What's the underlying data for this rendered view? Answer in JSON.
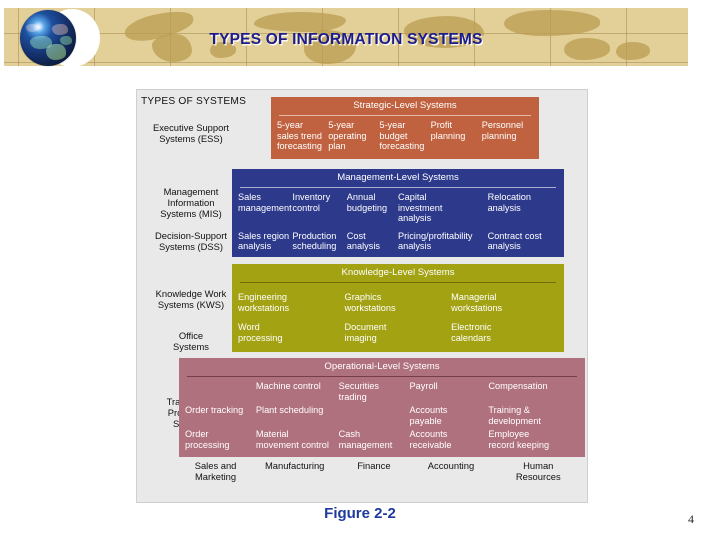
{
  "slide": {
    "banner_title": "TYPES OF INFORMATION SYSTEMS",
    "figure_caption": "Figure 2-2",
    "slide_number": "4"
  },
  "diagram": {
    "corner_label": "TYPES OF SYSTEMS",
    "system_types": [
      {
        "id": "ess",
        "label": "Executive Support\nSystems (ESS)"
      },
      {
        "id": "mis",
        "label": "Management\nInformation\nSystems (MIS)"
      },
      {
        "id": "dss",
        "label": "Decision-Support\nSystems (DSS)"
      },
      {
        "id": "kws",
        "label": "Knowledge Work\nSystems (KWS)"
      },
      {
        "id": "office",
        "label": "Office\nSystems"
      },
      {
        "id": "tps",
        "label": "Transaction\nProcessing\nSystems\n(TPS)"
      }
    ],
    "bands": [
      {
        "id": "strategic",
        "title": "Strategic-Level Systems",
        "color": "#C0623F",
        "rows": [
          [
            "5-year\nsales trend\nforecasting",
            "5-year\noperating\nplan",
            "5-year\nbudget\nforecasting",
            "Profit\nplanning",
            "Personnel\nplanning"
          ]
        ]
      },
      {
        "id": "management",
        "title": "Management-Level Systems",
        "color": "#2D3A8C",
        "rows": [
          [
            "Sales\nmanagement",
            "Inventory\ncontrol",
            "Annual\nbudgeting",
            "Capital\ninvestment\nanalysis",
            "Relocation\nanalysis"
          ],
          [
            "Sales region\nanalysis",
            "Production\nscheduling",
            "Cost\nanalysis",
            "Pricing/profitability\nanalysis",
            "Contract cost\nanalysis"
          ]
        ]
      },
      {
        "id": "knowledge",
        "title": "Knowledge-Level Systems",
        "color": "#A3A213",
        "rows": [
          [
            "Engineering\nworkstations",
            "Graphics\nworkstations",
            "Managerial\nworkstations"
          ],
          [
            "Word\nprocessing",
            "Document\nimaging",
            "Electronic\ncalendars"
          ]
        ]
      },
      {
        "id": "operational",
        "title": "Operational-Level Systems",
        "color": "#B0717F",
        "rows": [
          [
            "",
            "Machine control",
            "Securities\ntrading",
            "Payroll",
            "Compensation"
          ],
          [
            "Order tracking",
            "Plant scheduling",
            "",
            "Accounts\npayable",
            "Training &\ndevelopment"
          ],
          [
            "Order processing",
            "Material\nmovement control",
            "Cash\nmanagement",
            "Accounts\nreceivable",
            "Employee\nrecord keeping"
          ]
        ]
      }
    ],
    "functional_areas": [
      "Sales and\nMarketing",
      "Manufacturing",
      "Finance",
      "Accounting",
      "Human\nResources"
    ]
  }
}
